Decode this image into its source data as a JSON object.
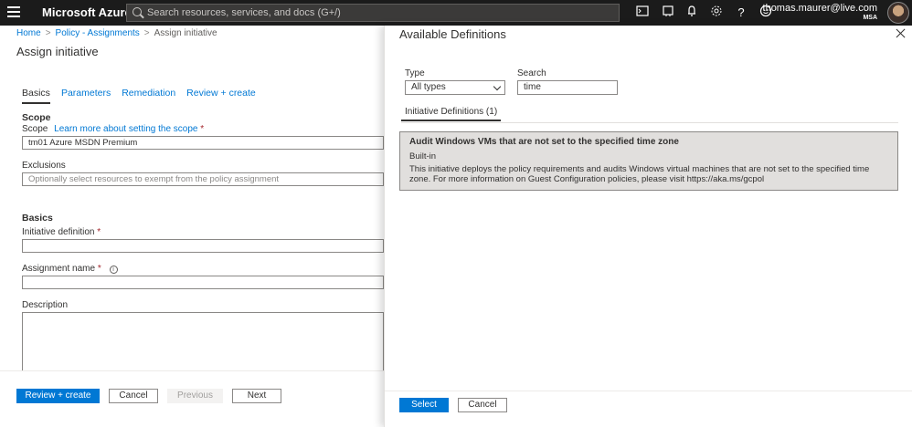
{
  "topbar": {
    "brand": "Microsoft Azure",
    "search_placeholder": "Search resources, services, and docs (G+/)",
    "icons": [
      "cloud-shell-icon",
      "directory-filter-icon",
      "bell-icon",
      "gear-icon",
      "help-icon",
      "feedback-icon"
    ],
    "account_email": "thomas.maurer@live.com",
    "account_tenant": "MSA"
  },
  "breadcrumb": [
    "Home",
    "Policy - Assignments",
    "Assign initiative"
  ],
  "page_title": "Assign initiative",
  "tabs": [
    "Basics",
    "Parameters",
    "Remediation",
    "Review + create"
  ],
  "form": {
    "scope_section": "Scope",
    "scope_label": "Scope",
    "scope_link": "Learn more about setting the scope",
    "scope_value": "tm01 Azure MSDN Premium",
    "exclusions_label": "Exclusions",
    "exclusions_placeholder": "Optionally select resources to exempt from the policy assignment",
    "basics_section": "Basics",
    "initiative_label": "Initiative definition",
    "assignment_label": "Assignment name",
    "description_label": "Description",
    "required_mark": "*"
  },
  "footer_left": {
    "review": "Review + create",
    "cancel": "Cancel",
    "previous": "Previous",
    "next": "Next"
  },
  "panel": {
    "title": "Available Definitions",
    "type_label": "Type",
    "type_value": "All types",
    "search_label": "Search",
    "search_value": "time",
    "tab": "Initiative Definitions (1)",
    "card": {
      "title": "Audit Windows VMs that are not set to the specified time zone",
      "type": "Built-in",
      "desc": "This initiative deploys the policy requirements and audits Windows virtual machines that are not set to the specified time zone. For more information on Guest Configuration policies, please visit https://aka.ms/gcpol"
    },
    "select": "Select",
    "cancel": "Cancel"
  },
  "colors": {
    "accent": "#0078d4",
    "topbar": "#1b1b1b"
  }
}
